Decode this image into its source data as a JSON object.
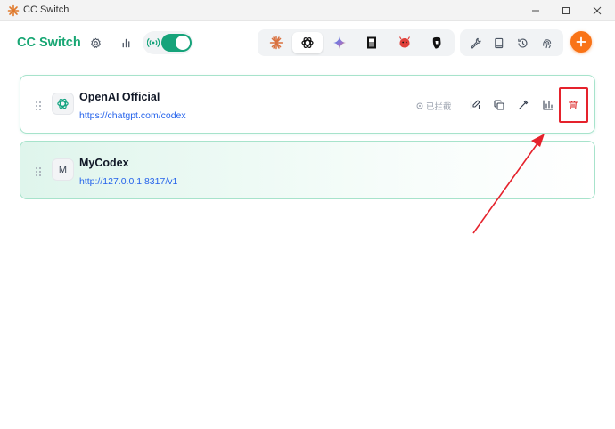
{
  "window": {
    "title": "CC Switch"
  },
  "header": {
    "brand": "CC Switch",
    "icons": [
      "settings-icon",
      "stats-icon",
      "proxy-icon"
    ],
    "proxy_toggle_on": true
  },
  "apps": [
    "claude-icon",
    "openai-icon",
    "gemini-icon",
    "opencode-icon",
    "openclaw-icon",
    "hermes-icon"
  ],
  "tools": [
    "wrench-icon",
    "book-icon",
    "history-icon",
    "fingerprint-icon"
  ],
  "colors": {
    "brand": "#17a673",
    "accent_orange": "#f97316",
    "card_border": "#a7e3cb",
    "link": "#2563eb",
    "danger": "#e5222c"
  },
  "providers": [
    {
      "name": "OpenAI Official",
      "url": "https://chatgpt.com/codex",
      "avatar_icon": "openai-icon",
      "status": "已拦截",
      "actions": [
        "edit-icon",
        "copy-icon",
        "test-icon",
        "usage-icon",
        "delete-icon"
      ]
    },
    {
      "name": "MyCodex",
      "url": "http://127.0.0.1:8317/v1",
      "avatar_letter": "M",
      "active": true
    }
  ]
}
